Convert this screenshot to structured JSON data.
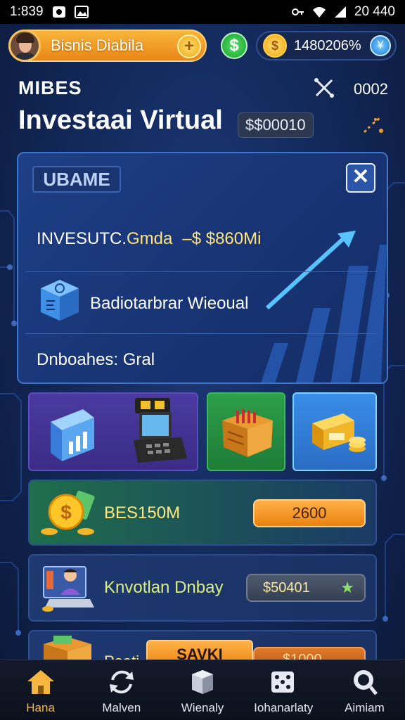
{
  "status_bar": {
    "time": "1:839",
    "right_text": "20 440"
  },
  "header": {
    "profile_name": "Bisnis Diabila",
    "plus_label": "+",
    "cash_label": "$",
    "stat_value": "1480206%",
    "coin_label": "$",
    "gem_label": "¥"
  },
  "section": {
    "label": "MIBES",
    "tools_count": "0002"
  },
  "title": {
    "text": "Investaai Virtual",
    "balance": "$$00010"
  },
  "panel": {
    "tag": "UBAME",
    "close_label": "✕",
    "row1_label": "INVESUTC.",
    "row1_sub": "Gmda",
    "row1_amount": "–$ $860Mi",
    "row2_label": "Badiotarbrar Wieoual",
    "row3_label": "Dnboahes: Gral"
  },
  "cards": [
    {
      "label": "BES150M",
      "button": "2600"
    },
    {
      "label": "Knvotlan Dnbay",
      "button": "$50401"
    },
    {
      "label": "Poati",
      "button": "$1000"
    }
  ],
  "floating_button": "SAVKI",
  "nav": [
    {
      "label": "Hana",
      "icon": "home-icon",
      "active": true
    },
    {
      "label": "Malven",
      "icon": "refresh-icon",
      "active": false
    },
    {
      "label": "Wienaly",
      "icon": "box-icon",
      "active": false
    },
    {
      "label": "Iohanarlaty",
      "icon": "dice-icon",
      "active": false
    },
    {
      "label": "Aimiam",
      "icon": "search-icon",
      "active": false
    }
  ],
  "colors": {
    "accent_orange": "#f0a030",
    "panel_blue": "#1e3f86",
    "nav_active": "#f5b740"
  }
}
